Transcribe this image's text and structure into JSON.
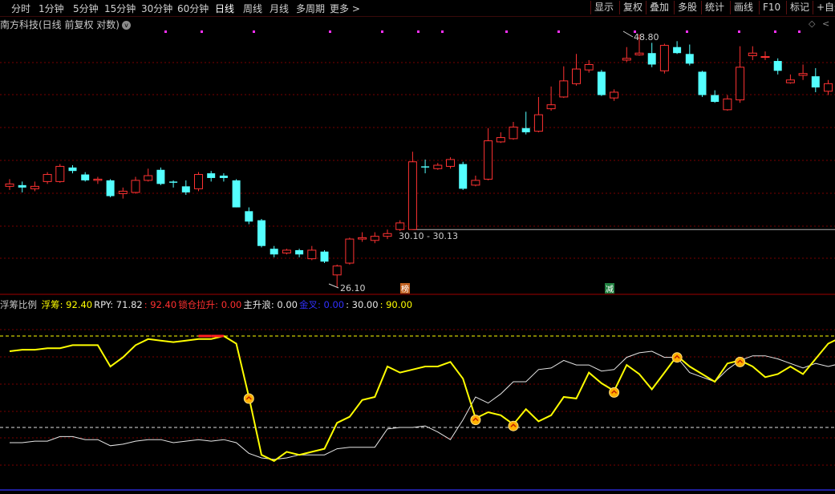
{
  "toolbar": {
    "timeframes": [
      "分时",
      "1分钟",
      "5分钟",
      "15分钟",
      "30分钟",
      "60分钟",
      "日线",
      "周线",
      "月线",
      "多周期",
      "更多 >"
    ],
    "active": "日线",
    "right_buttons": [
      "显示",
      "复权",
      "叠加",
      "多股",
      "统计",
      "画线",
      "F10",
      "标记",
      "+自选"
    ]
  },
  "title": "南方科技(日线 前复权 对数)",
  "title_icon": "v",
  "controls": [
    "◇",
    "<"
  ],
  "price_chart": {
    "high_label": "48.80",
    "low_label": "26.10",
    "range_label": "30.10 - 30.13",
    "tag_bang": "榜",
    "tag_jian": "减"
  },
  "indicator_legend": {
    "name": "浮筹比例",
    "items": [
      {
        "label": "浮筹:",
        "value": "92.40",
        "color": "#ffff00"
      },
      {
        "label": "RPY:",
        "value": "71.82",
        "color": "#e6e6e6"
      },
      {
        "label": ":",
        "value": "92.40",
        "color": "#ff3030"
      },
      {
        "label": "锁仓拉升:",
        "value": "0.00",
        "color": "#ff3030"
      },
      {
        "label": "主升浪:",
        "value": "0.00",
        "color": "#e6e6e6"
      },
      {
        "label": "金叉:",
        "value": "0.00",
        "color": "#3030ff"
      },
      {
        "label": ":",
        "value": "30.00",
        "color": "#e6e6e6"
      },
      {
        "label": ":",
        "value": "90.00",
        "color": "#ffff00"
      }
    ]
  },
  "chart_data": {
    "type": "candlestick",
    "price_axis": {
      "min": 26.1,
      "max": 48.8
    },
    "candles": [
      [
        33.5,
        33.7,
        34.1,
        33.2
      ],
      [
        33.6,
        33.4,
        33.9,
        33.0
      ],
      [
        33.3,
        33.5,
        33.9,
        33.1
      ],
      [
        33.9,
        34.5,
        34.7,
        33.7
      ],
      [
        33.9,
        35.2,
        35.4,
        33.8
      ],
      [
        35.1,
        34.8,
        35.3,
        34.6
      ],
      [
        34.5,
        34.0,
        34.7,
        33.9
      ],
      [
        34.0,
        34.1,
        34.3,
        33.7
      ],
      [
        34.0,
        32.7,
        34.1,
        32.6
      ],
      [
        32.9,
        33.1,
        33.4,
        32.5
      ],
      [
        33.0,
        34.0,
        34.3,
        32.9
      ],
      [
        34.0,
        34.4,
        35.0,
        33.9
      ],
      [
        34.9,
        33.7,
        35.1,
        33.6
      ],
      [
        33.9,
        33.8,
        34.0,
        33.4
      ],
      [
        33.5,
        33.0,
        34.0,
        32.8
      ],
      [
        33.3,
        34.5,
        34.7,
        33.1
      ],
      [
        34.6,
        34.2,
        34.8,
        33.9
      ],
      [
        34.4,
        34.2,
        34.6,
        33.9
      ],
      [
        34.0,
        31.8,
        34.1,
        31.8
      ],
      [
        31.5,
        30.7,
        31.8,
        30.5
      ],
      [
        30.8,
        28.9,
        30.9,
        28.8
      ],
      [
        28.7,
        28.3,
        28.9,
        28.1
      ],
      [
        28.4,
        28.6,
        28.7,
        28.3
      ],
      [
        28.6,
        28.3,
        28.7,
        28.1
      ],
      [
        28.0,
        28.6,
        28.9,
        27.9
      ],
      [
        28.5,
        27.8,
        28.6,
        27.7
      ],
      [
        26.9,
        27.5,
        27.6,
        26.1
      ],
      [
        27.7,
        29.4,
        29.5,
        27.6
      ],
      [
        29.4,
        29.5,
        29.9,
        29.2
      ],
      [
        29.3,
        29.6,
        29.9,
        29.1
      ],
      [
        29.6,
        29.8,
        30.1,
        29.4
      ],
      [
        30.1,
        30.6,
        30.8,
        30.0
      ],
      [
        30.1,
        35.6,
        36.5,
        30.1
      ],
      [
        35.2,
        35.1,
        35.8,
        34.6
      ],
      [
        35.0,
        35.3,
        35.5,
        34.9
      ],
      [
        35.2,
        35.8,
        36.0,
        35.0
      ],
      [
        35.4,
        33.3,
        35.6,
        33.2
      ],
      [
        33.6,
        34.0,
        34.4,
        33.5
      ],
      [
        34.1,
        37.5,
        38.7,
        34.0
      ],
      [
        37.4,
        37.8,
        38.3,
        37.3
      ],
      [
        37.7,
        38.8,
        39.3,
        37.6
      ],
      [
        38.7,
        38.3,
        40.3,
        38.1
      ],
      [
        38.4,
        40.0,
        41.8,
        38.3
      ],
      [
        40.6,
        41.0,
        42.9,
        40.4
      ],
      [
        41.8,
        43.5,
        45.1,
        41.7
      ],
      [
        43.2,
        44.8,
        46.5,
        43.0
      ],
      [
        44.7,
        45.3,
        45.8,
        44.4
      ],
      [
        44.5,
        42.0,
        44.7,
        41.9
      ],
      [
        41.7,
        42.3,
        42.6,
        41.4
      ],
      [
        45.8,
        46.0,
        47.3,
        45.6
      ],
      [
        46.4,
        46.6,
        48.8,
        46.3
      ],
      [
        46.6,
        45.3,
        47.8,
        45.0
      ],
      [
        44.6,
        47.5,
        47.7,
        44.3
      ],
      [
        47.3,
        46.6,
        48.0,
        46.5
      ],
      [
        46.5,
        45.4,
        47.6,
        45.2
      ],
      [
        44.5,
        42.0,
        44.6,
        41.8
      ],
      [
        42.0,
        41.3,
        42.5,
        41.2
      ],
      [
        40.5,
        41.6,
        42.0,
        40.4
      ],
      [
        41.5,
        45.0,
        47.4,
        41.2
      ],
      [
        46.3,
        46.6,
        47.4,
        45.8
      ],
      [
        46.2,
        46.2,
        46.8,
        45.8
      ],
      [
        45.7,
        44.6,
        46.0,
        44.2
      ],
      [
        43.3,
        43.6,
        44.2,
        43.2
      ],
      [
        44.1,
        44.3,
        45.3,
        43.6
      ],
      [
        44.0,
        42.8,
        44.9,
        42.3
      ],
      [
        42.4,
        43.2,
        43.6,
        42.0
      ],
      [
        43.3,
        43.5,
        43.9,
        43.0
      ]
    ],
    "fuchou": [
      80,
      81,
      81,
      82,
      82,
      84,
      84,
      84,
      70,
      76,
      84,
      88,
      87,
      86,
      87,
      88,
      88,
      90,
      85,
      50,
      12,
      8,
      14,
      12,
      14,
      16,
      33,
      37,
      48,
      50,
      70,
      66,
      68,
      70,
      70,
      73,
      62,
      36,
      40,
      38,
      32,
      42,
      34,
      38,
      50,
      49,
      66,
      59,
      54,
      71,
      65,
      55,
      66,
      77,
      70,
      65,
      60,
      72,
      74,
      70,
      63,
      65,
      70,
      65,
      75,
      85,
      89
    ],
    "rpy": [
      20,
      20,
      21,
      21,
      24,
      24,
      22,
      22,
      18,
      19,
      21,
      22,
      22,
      20,
      21,
      22,
      21,
      22,
      20,
      13,
      10,
      9,
      10,
      12,
      12,
      12,
      16,
      17,
      17,
      17,
      29,
      30,
      30,
      31,
      27,
      22,
      35,
      50,
      46,
      52,
      60,
      60,
      68,
      69,
      74,
      71,
      71,
      67,
      68,
      76,
      79,
      80,
      76,
      76,
      66,
      63,
      60,
      68,
      74,
      77,
      77,
      75,
      72,
      69,
      72,
      70,
      72
    ],
    "lock_markers": [
      19,
      37,
      40,
      48,
      53,
      58
    ],
    "upper_line": 90,
    "lower_line": 30
  }
}
